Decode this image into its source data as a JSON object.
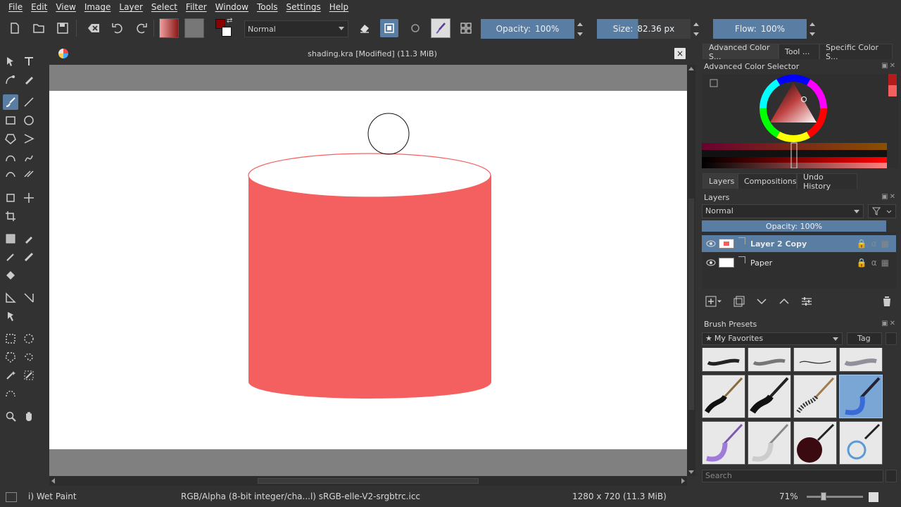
{
  "menu": [
    "File",
    "Edit",
    "View",
    "Image",
    "Layer",
    "Select",
    "Filter",
    "Window",
    "Tools",
    "Settings",
    "Help"
  ],
  "toolbar": {
    "blend_mode": "Normal",
    "opacity_label": "Opacity:",
    "opacity_value": "100%",
    "size_label": "Size:",
    "size_value": "82.36 px",
    "flow_label": "Flow:",
    "flow_value": "100%",
    "foreground_color": "#8b0000",
    "background_color": "#ffffff"
  },
  "document": {
    "title": "shading.kra [Modified]  (11.3 MiB)",
    "close_glyph": "×",
    "shape_color": "#f46060",
    "brush_outline": "circle"
  },
  "dockers": {
    "top_tabs": [
      "Advanced Color S...",
      "Tool ...",
      "Specific Color S..."
    ],
    "color_selector_title": "Advanced Color Selector",
    "layers_tabs": [
      "Layers",
      "Compositions",
      "Undo History"
    ],
    "layers_title": "Layers",
    "layer_blend": "Normal",
    "layer_opacity": "Opacity:  100%",
    "layers": [
      {
        "name": "Layer 2 Copy",
        "selected": true
      },
      {
        "name": "Paper",
        "selected": false
      }
    ],
    "presets_title": "Brush Presets",
    "preset_filter": "My Favorites",
    "preset_tag": "Tag",
    "search_placeholder": "Search"
  },
  "status": {
    "brush": "i) Wet Paint",
    "color_space": "RGB/Alpha (8-bit integer/cha...l)  sRGB-elle-V2-srgbtrc.icc",
    "dimensions": "1280 x 720 (11.3 MiB)",
    "zoom": "71%"
  }
}
